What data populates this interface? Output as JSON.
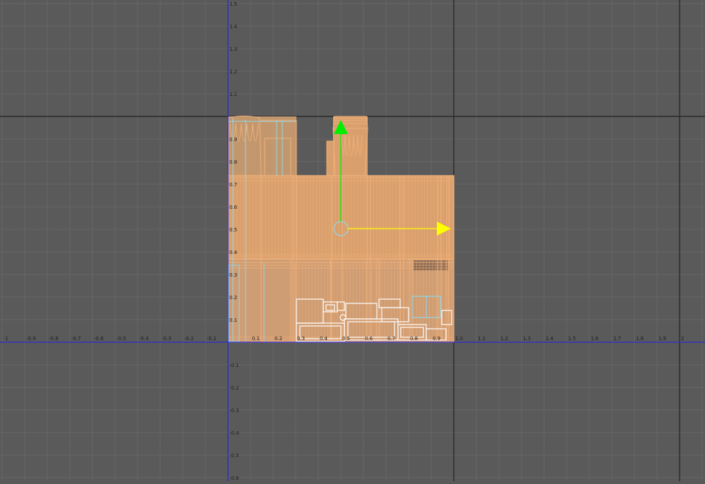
{
  "viewport": {
    "name": "front orthographic viewport",
    "background": "#5a5a5a",
    "colors": {
      "minor_grid": "#666666",
      "major_grid": "#222222",
      "x_axis": "#2a2ad8",
      "y_axis": "#2a2ad8",
      "mesh_fill": "#d9a06e",
      "mesh_wire": "#f0b078",
      "selected_wire": "#8fd8e8",
      "white_wire": "#ffffff",
      "gizmo_x": "#ffff00",
      "gizmo_y": "#00ee00",
      "pivot": "#8fd8e8"
    }
  },
  "grid": {
    "x_labels": [
      "-1",
      "-0.9",
      "-0.8",
      "-0.7",
      "-0.6",
      "-0.5",
      "-0.4",
      "-0.3",
      "-0.2",
      "-0.1",
      "0.1",
      "0.2",
      "0.3",
      "0.4",
      "0.5",
      "0.6",
      "0.7",
      "0.8",
      "0.9",
      "1.0",
      "1.1",
      "1.2",
      "1.3",
      "1.4",
      "1.5",
      "1.6",
      "1.7",
      "1.8",
      "1.9",
      "2"
    ],
    "y_labels_upper": [
      "1.5",
      "1.4",
      "1.3",
      "1.2",
      "1.1",
      "0.9",
      "0.8",
      "0.7",
      "0.6",
      "0.5",
      "0.4",
      "0.3",
      "0.2",
      "0.1"
    ],
    "y_labels_lower": [
      "-0.1",
      "-0.2",
      "-0.3",
      "-0.4",
      "-0.5",
      "-0.6"
    ]
  },
  "gizmo": {
    "type": "move manipulator",
    "axes": [
      "x",
      "y"
    ]
  }
}
